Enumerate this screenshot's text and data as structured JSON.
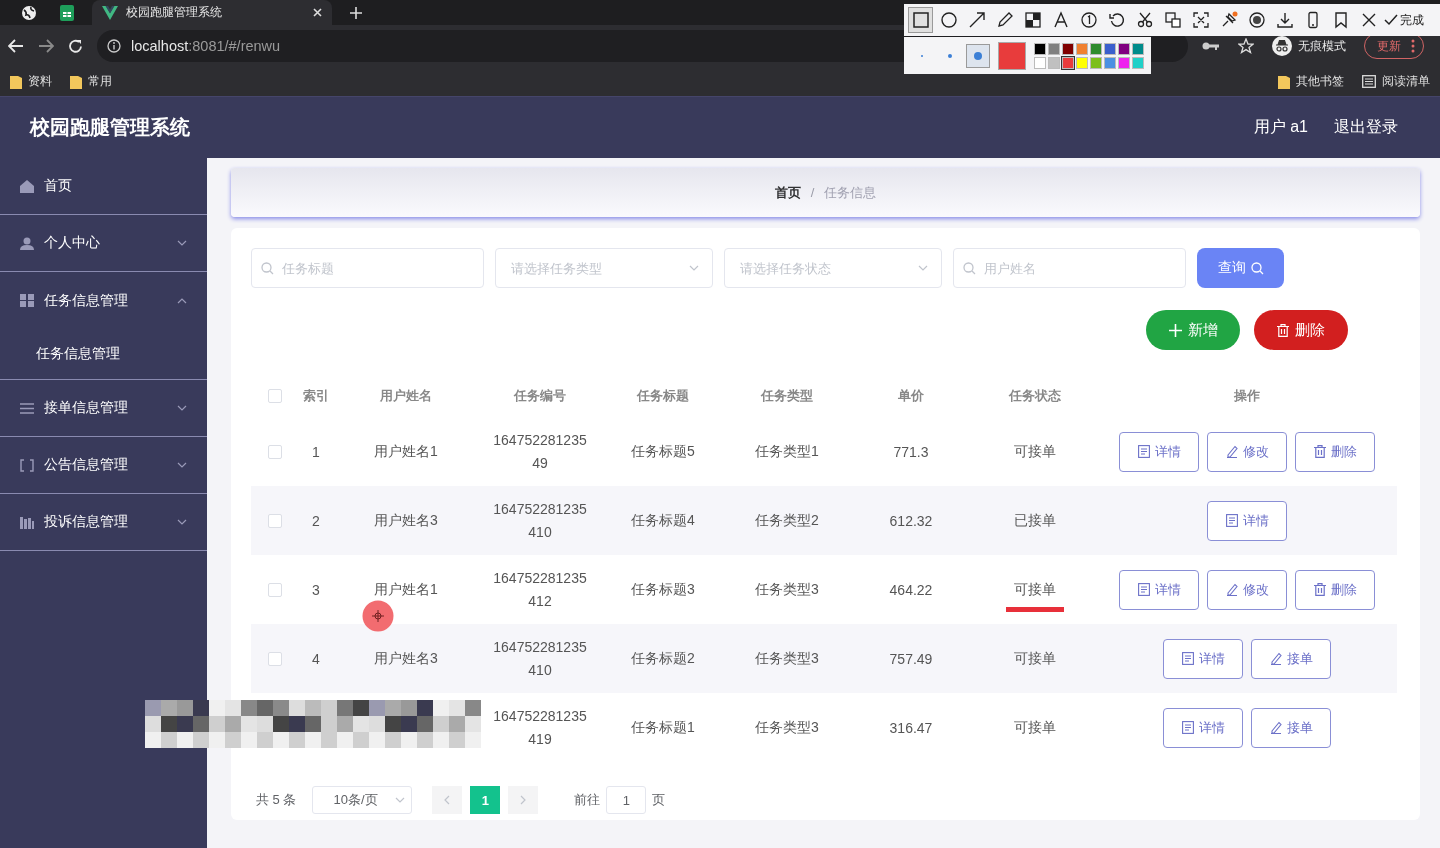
{
  "browser": {
    "tabs": [
      {
        "kind": "globe",
        "selected": false
      },
      {
        "kind": "sheet",
        "selected": false
      },
      {
        "kind": "vue",
        "title": "校园跑腿管理系统",
        "selected": true
      }
    ],
    "address": {
      "host": "localhost",
      "path": ":8081/#/renwu"
    },
    "incognito_label": "无痕模式",
    "update_label": "更新",
    "bookmarks_left": [
      "资料",
      "常用"
    ],
    "bookmarks_right": [
      {
        "kind": "folder",
        "label": "其他书签"
      },
      {
        "kind": "list",
        "label": "阅读清单"
      }
    ]
  },
  "capture_toolbar": {
    "tools": [
      {
        "kind": "rect",
        "selected": true
      },
      {
        "kind": "ellipse",
        "selected": false
      },
      {
        "kind": "arrow",
        "selected": false
      },
      {
        "kind": "pen",
        "selected": false
      },
      {
        "kind": "mosaic",
        "selected": false
      },
      {
        "kind": "text",
        "selected": false
      },
      {
        "kind": "number",
        "selected": false
      },
      {
        "kind": "undo",
        "selected": false
      },
      {
        "kind": "cut",
        "selected": false
      },
      {
        "kind": "translate",
        "selected": false
      },
      {
        "kind": "ocr",
        "selected": false
      },
      {
        "kind": "pin",
        "selected": false
      },
      {
        "kind": "record",
        "selected": false
      },
      {
        "kind": "download",
        "selected": false
      },
      {
        "kind": "phone",
        "selected": false
      },
      {
        "kind": "bookmark",
        "selected": false
      },
      {
        "kind": "close",
        "selected": false
      }
    ],
    "done_label": "完成",
    "sizes": [
      {
        "selected": false
      },
      {
        "selected": false
      },
      {
        "selected": true
      }
    ],
    "palette": [
      {
        "color": "#000000",
        "selected": false
      },
      {
        "color": "#808080",
        "selected": false
      },
      {
        "color": "#800000",
        "selected": false
      },
      {
        "color": "#f08030",
        "selected": false
      },
      {
        "color": "#2e8b2e",
        "selected": false
      },
      {
        "color": "#3a5fcd",
        "selected": false
      },
      {
        "color": "#800080",
        "selected": false
      },
      {
        "color": "#008b8b",
        "selected": false
      },
      {
        "color": "#ffffff",
        "selected": false
      },
      {
        "color": "#c0c0c0",
        "selected": false
      },
      {
        "color": "#e83c3c",
        "selected": true
      },
      {
        "color": "#ffff00",
        "selected": false
      },
      {
        "color": "#7cbf1c",
        "selected": false
      },
      {
        "color": "#4a90e2",
        "selected": false
      },
      {
        "color": "#ee22ee",
        "selected": false
      },
      {
        "color": "#20d0c8",
        "selected": false
      }
    ]
  },
  "header": {
    "title": "校园跑腿管理系统",
    "user": "用户 a1",
    "logout": "退出登录"
  },
  "sidebar": {
    "items": [
      {
        "kind": "home",
        "label": "首页"
      },
      {
        "kind": "user",
        "label": "个人中心",
        "expanded": false
      },
      {
        "kind": "grid",
        "label": "任务信息管理",
        "expanded": true,
        "children": [
          {
            "label": "任务信息管理"
          }
        ]
      },
      {
        "kind": "lines",
        "label": "接单信息管理",
        "expanded": false
      },
      {
        "kind": "frame",
        "label": "公告信息管理",
        "expanded": false
      },
      {
        "kind": "bars",
        "label": "投诉信息管理",
        "expanded": false
      }
    ]
  },
  "breadcrumb": [
    "首页",
    "任务信息"
  ],
  "breadcrumb_separator": "/",
  "filters": [
    {
      "kind": "search",
      "placeholder": "任务标题"
    },
    {
      "kind": "select",
      "placeholder": "请选择任务类型"
    },
    {
      "kind": "select",
      "placeholder": "请选择任务状态"
    },
    {
      "kind": "search",
      "placeholder": "用户姓名"
    }
  ],
  "query_button": "查询",
  "actions": [
    {
      "kind": "add",
      "label": "新增"
    },
    {
      "kind": "delete",
      "label": "删除"
    }
  ],
  "table": {
    "header_checked": false,
    "columns": [
      "索引",
      "用户姓名",
      "任务编号",
      "任务标题",
      "任务类型",
      "单价",
      "任务状态",
      "操作"
    ],
    "rows": [
      {
        "checked": false,
        "index": "1",
        "user": "用户姓名1",
        "number": "16475228123549",
        "title": "任务标题5",
        "type": "任务类型1",
        "price": "771.3",
        "status": "可接单",
        "underlined": false,
        "masked": false,
        "actions": [
          {
            "kind": "detail",
            "label": "详情"
          },
          {
            "kind": "edit",
            "label": "修改"
          },
          {
            "kind": "delete",
            "label": "删除"
          }
        ]
      },
      {
        "checked": false,
        "index": "2",
        "user": "用户姓名3",
        "number": "164752281235410",
        "title": "任务标题4",
        "type": "任务类型2",
        "price": "612.32",
        "status": "已接单",
        "underlined": false,
        "masked": false,
        "actions": [
          {
            "kind": "detail",
            "label": "详情"
          }
        ]
      },
      {
        "checked": false,
        "index": "3",
        "user": "用户姓名1",
        "number": "164752281235412",
        "title": "任务标题3",
        "type": "任务类型3",
        "price": "464.22",
        "status": "可接单",
        "underlined": true,
        "masked": false,
        "actions": [
          {
            "kind": "detail",
            "label": "详情"
          },
          {
            "kind": "edit",
            "label": "修改"
          },
          {
            "kind": "delete",
            "label": "删除"
          }
        ]
      },
      {
        "checked": false,
        "index": "4",
        "user": "用户姓名3",
        "number": "164752281235410",
        "title": "任务标题2",
        "type": "任务类型3",
        "price": "757.49",
        "status": "可接单",
        "underlined": false,
        "masked": false,
        "actions": [
          {
            "kind": "detail",
            "label": "详情"
          },
          {
            "kind": "take",
            "label": "接单"
          }
        ]
      },
      {
        "number": "164752281235419",
        "title": "任务标题1",
        "type": "任务类型3",
        "price": "316.47",
        "status": "可接单",
        "underlined": false,
        "masked": true,
        "actions": [
          {
            "kind": "detail",
            "label": "详情"
          },
          {
            "kind": "take",
            "label": "接单"
          }
        ]
      }
    ]
  },
  "pagination": {
    "total": "共 5 条",
    "page_size": "10条/页",
    "pages": [
      {
        "label": "1",
        "selected": true
      }
    ],
    "goto_label": "前往",
    "goto_value": "1",
    "page_suffix": "页"
  }
}
